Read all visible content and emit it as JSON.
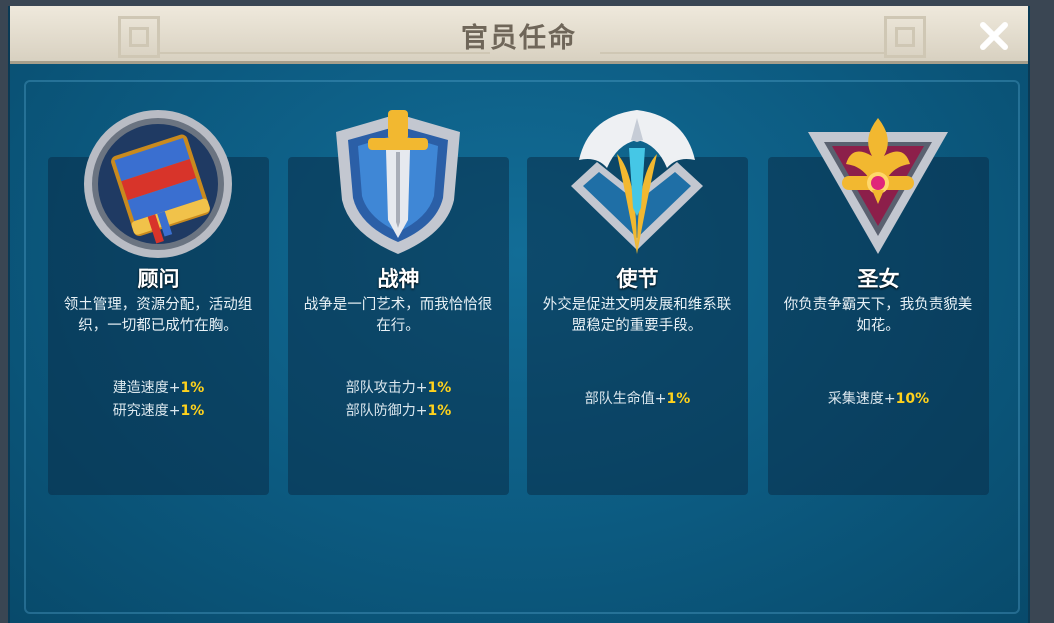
{
  "dialog": {
    "title": "官员任命",
    "close_label": "✕"
  },
  "cards": [
    {
      "title": "顾问",
      "desc": "领土管理，资源分配，活动组织，一切都已成竹在胸。",
      "emblem": "book-icon",
      "bonuses": [
        {
          "label": "建造速度+",
          "value": "1%"
        },
        {
          "label": "研究速度+",
          "value": "1%"
        }
      ]
    },
    {
      "title": "战神",
      "desc": "战争是一门艺术，而我恰恰很在行。",
      "emblem": "sword-shield-icon",
      "bonuses": [
        {
          "label": "部队攻击力+",
          "value": "1%"
        },
        {
          "label": "部队防御力+",
          "value": "1%"
        }
      ]
    },
    {
      "title": "使节",
      "desc": "外交是促进文明发展和维系联盟稳定的重要手段。",
      "emblem": "envoy-crest-icon",
      "bonuses": [
        {
          "label": "部队生命值+",
          "value": "1%"
        }
      ]
    },
    {
      "title": "圣女",
      "desc": "你负责争霸天下，我负责貌美如花。",
      "emblem": "fleur-de-lis-icon",
      "bonuses": [
        {
          "label": "采集速度+",
          "value": "10%"
        }
      ]
    }
  ],
  "colors": {
    "accent_value": "#ffd21c",
    "panel_bg": "#0c5a80",
    "header_bg": "#efe9dc"
  }
}
